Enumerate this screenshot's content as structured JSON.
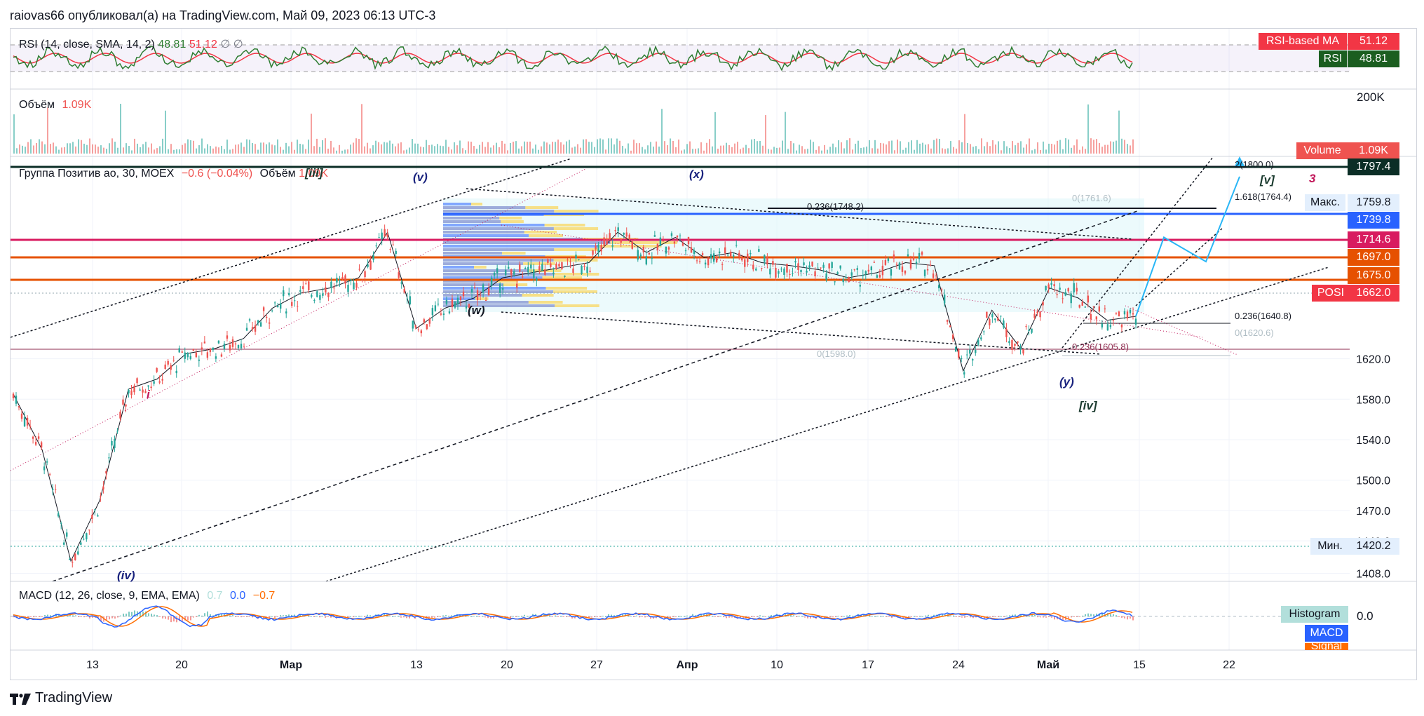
{
  "publish_info": "raiovas66 опубликовал(а) на TradingView.com, Май 09, 2023 06:13 UTC-3",
  "brand": "TradingView",
  "colors": {
    "up": "#26a69a",
    "down": "#ef5350",
    "rsi": "#2e7d32",
    "rsi_ma": "#f23645",
    "macd": "#2962ff",
    "signal": "#ff6d00",
    "blue_level": "#2962ff",
    "orange_level": "#e65100",
    "magenta_level": "#d81b60",
    "dark": "#0b2e26"
  },
  "rsi_pane": {
    "title": "RSI (14, close, SMA, 14, 2)",
    "value1": "48.81",
    "value2": "51.12",
    "value3": "∅",
    "value4": "∅",
    "tags": [
      {
        "label": "RSI-based MA",
        "value": "51.12",
        "color": "#f23645"
      },
      {
        "label": "RSI",
        "value": "48.81",
        "color": "#1b5e20"
      }
    ]
  },
  "volume_pane": {
    "title": "Объём",
    "value": "1.09K",
    "axis_label": "200K",
    "tag": {
      "label": "Volume",
      "value": "1.09K",
      "color": "#ef5350"
    }
  },
  "main_pane": {
    "title": "Группа Позитив ао, 30, MOEX",
    "change": "−0.6 (−0.04%)",
    "vol_label": "Объём",
    "vol_value": "1.09K",
    "axis_ticks": [
      "1620.0",
      "1580.0",
      "1540.0",
      "1500.0",
      "1470.0",
      "1440.0",
      "1408.0"
    ],
    "price_tags": [
      {
        "label": "",
        "value": "1797.4",
        "color": "#0b2e26"
      },
      {
        "label": "Макс.",
        "value": "1759.8",
        "color": "#e3effd"
      },
      {
        "label": "",
        "value": "1739.8",
        "color": "#2962ff"
      },
      {
        "label": "",
        "value": "1714.6",
        "color": "#d81b60"
      },
      {
        "label": "",
        "value": "1697.0",
        "color": "#e65100"
      },
      {
        "label": "",
        "value": "1675.0",
        "color": "#e65100"
      },
      {
        "label": "POSI",
        "value": "1662.0",
        "color": "#f23645"
      },
      {
        "label": "Мин.",
        "value": "1420.2",
        "color": "#e3effd"
      }
    ],
    "fib_labels": [
      "2(1800.0)",
      "1.618(1764.4)",
      "0(1761.6)",
      "0.236(1748.2)",
      "0.236(1640.8)",
      "0(1620.6)",
      "0.236(1605.8)",
      "0(1598.0)"
    ],
    "wave_labels": [
      "(v)",
      "(x)",
      "(w)",
      "(y)",
      "[iv]",
      "[v]",
      "3",
      "i",
      "(iv)",
      "[iii]"
    ]
  },
  "macd_pane": {
    "title": "MACD (12, 26, close, 9, EMA, EMA)",
    "v1": "0.7",
    "v2": "0.0",
    "v3": "−0.7",
    "axis_label": "0.0",
    "tags": [
      {
        "label": "Histogram",
        "color": "#b2dfdb",
        "text": "#131722"
      },
      {
        "label": "MACD",
        "color": "#2962ff",
        "text": "#ffffff"
      },
      {
        "label": "Signal",
        "color": "#ff6d00",
        "text": "#ffffff"
      }
    ]
  },
  "x_axis": [
    "13",
    "20",
    "Мар",
    "13",
    "20",
    "27",
    "Апр",
    "10",
    "17",
    "24",
    "Май",
    "15",
    "22"
  ],
  "chart_data": {
    "type": "line",
    "series": [
      {
        "name": "Группа Позитив ао",
        "x": [
          "Фев 13",
          "Фев 15",
          "Фев 17",
          "Фев 20",
          "Фев 22",
          "Фев 24",
          "Фев 27",
          "Мар 01",
          "Мар 03",
          "Мар 06",
          "Мар 08",
          "Мар 10",
          "Мар 13",
          "Мар 15",
          "Мар 17",
          "Мар 20",
          "Мар 22",
          "Мар 24",
          "Мар 27",
          "Мар 29",
          "Мар 31",
          "Апр 03",
          "Апр 05",
          "Апр 07",
          "Апр 10",
          "Апр 12",
          "Апр 14",
          "Апр 17",
          "Апр 19",
          "Апр 21",
          "Апр 24",
          "Апр 26",
          "Апр 28",
          "Май 01",
          "Май 02",
          "Май 03",
          "Май 04",
          "Май 05",
          "Май 08",
          "Май 09"
        ],
        "y": [
          1585,
          1530,
          1420,
          1480,
          1590,
          1600,
          1625,
          1630,
          1640,
          1670,
          1685,
          1690,
          1700,
          1745,
          1650,
          1670,
          1680,
          1700,
          1705,
          1710,
          1715,
          1745,
          1725,
          1740,
          1720,
          1725,
          1715,
          1712,
          1708,
          1700,
          1705,
          1715,
          1712,
          1608,
          1668,
          1630,
          1690,
          1680,
          1658,
          1662
        ]
      }
    ],
    "ylim": [
      1400,
      1820
    ],
    "levels": [
      1797.4,
      1759.8,
      1748.2,
      1739.8,
      1714.6,
      1697.0,
      1675.0,
      1662.0,
      1605.8,
      1420.2
    ],
    "projection": [
      1662,
      1740,
      1716,
      1800
    ],
    "grid": true
  }
}
